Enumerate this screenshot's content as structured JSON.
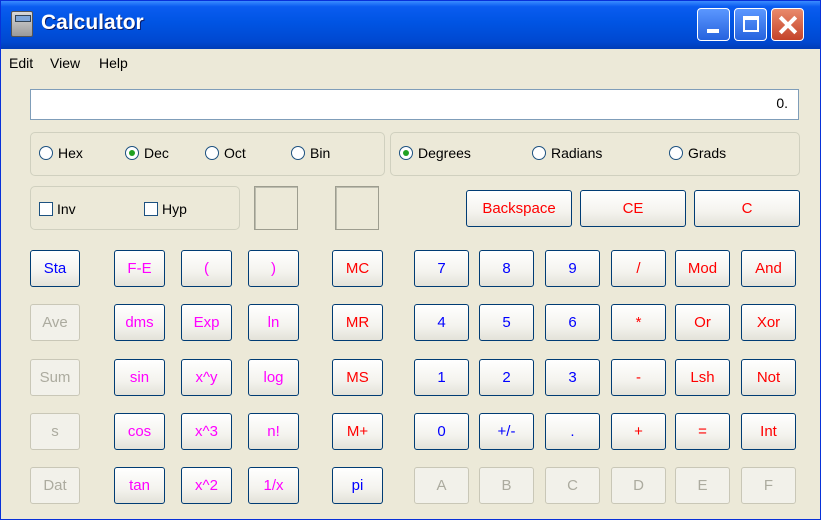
{
  "window": {
    "title": "Calculator"
  },
  "menu": [
    "Edit",
    "View",
    "Help"
  ],
  "display": {
    "value": "0."
  },
  "number_system": [
    {
      "label": "Hex",
      "checked": false
    },
    {
      "label": "Dec",
      "checked": true
    },
    {
      "label": "Oct",
      "checked": false
    },
    {
      "label": "Bin",
      "checked": false
    }
  ],
  "angle_mode": [
    {
      "label": "Degrees",
      "checked": true
    },
    {
      "label": "Radians",
      "checked": false
    },
    {
      "label": "Grads",
      "checked": false
    }
  ],
  "options": [
    {
      "label": "Inv",
      "checked": false
    },
    {
      "label": "Hyp",
      "checked": false
    }
  ],
  "edit_buttons": {
    "backspace": "Backspace",
    "ce": "CE",
    "c": "C"
  },
  "stat_buttons": [
    "Sta",
    "Ave",
    "Sum",
    "s",
    "Dat"
  ],
  "function_col1": [
    "F-E",
    "dms",
    "sin",
    "cos",
    "tan"
  ],
  "function_col2": [
    "(",
    "Exp",
    "x^y",
    "x^3",
    "x^2"
  ],
  "function_col3": [
    ")",
    "ln",
    "log",
    "n!",
    "1/x"
  ],
  "memory_buttons": [
    "MC",
    "MR",
    "MS",
    "M+",
    "pi"
  ],
  "digit_rows": [
    [
      "7",
      "8",
      "9",
      "/",
      "Mod",
      "And"
    ],
    [
      "4",
      "5",
      "6",
      "*",
      "Or",
      "Xor"
    ],
    [
      "1",
      "2",
      "3",
      "-",
      "Lsh",
      "Not"
    ],
    [
      "0",
      "+/-",
      ".",
      "+",
      "=",
      "Int"
    ],
    [
      "A",
      "B",
      "C",
      "D",
      "E",
      "F"
    ]
  ],
  "colors": {
    "title_bar": "#0054E3",
    "window_face": "#ECE9D8",
    "digit_text": "#0000ff",
    "operator_text": "#ff0000",
    "function_text": "#ff00ff",
    "disabled_text": "#acab9f"
  }
}
